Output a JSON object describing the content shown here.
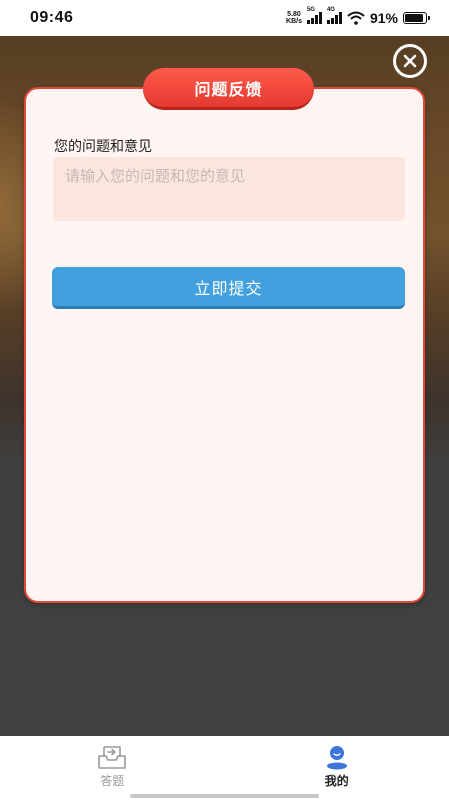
{
  "status_bar": {
    "time": "09:46",
    "net_speed_value": "5.80",
    "net_speed_unit": "KB/s",
    "sim1_gen": "5G",
    "sim2_gen": "4G",
    "battery_percent": "91%",
    "battery_level": 0.91
  },
  "dialog": {
    "title": "问题反馈",
    "field_label": "您的问题和意见",
    "input_value": "",
    "input_placeholder": "请输入您的问题和您的意见",
    "submit_label": "立即提交"
  },
  "bottom_nav": {
    "items": [
      {
        "label": "答题",
        "icon": "answer-tray-icon",
        "active": false
      },
      {
        "label": "我的",
        "icon": "user-profile-icon",
        "active": true
      }
    ]
  },
  "colors": {
    "accent_red": "#e43a30",
    "submit_blue": "#43a0de",
    "dialog_bg": "#fff6f3",
    "nav_active_icon": "#3f74d8"
  }
}
